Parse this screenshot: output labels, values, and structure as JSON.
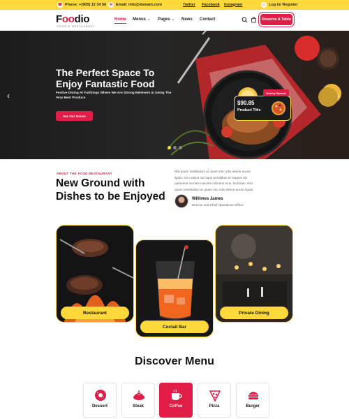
{
  "topbar": {
    "phone": "Phone: +(900) 12 34 56",
    "email": "Email: info@domain.com",
    "links": [
      "Twitter",
      "Facebook",
      "Instagram"
    ],
    "login": "Log in/ Register"
  },
  "header": {
    "logo": "Foodio",
    "logo_sub": "FOOD'S RESTAURANT",
    "nav": [
      {
        "label": "Home"
      },
      {
        "label": "Menus"
      },
      {
        "label": "Pages"
      },
      {
        "label": "News"
      },
      {
        "label": "Contact"
      }
    ],
    "reserve_button": "Reserve A Table"
  },
  "hero": {
    "title": "The Perfect Space To Enjoy Fantastic Food",
    "description": "Festive Dining At Farthings Where We Are Strong Believers In Using The Very Best Produce",
    "button": "See Our Menus",
    "slide_count": 3,
    "active_slide": 1,
    "special": {
      "badge": "Weekly Special",
      "price": "$90.85",
      "name": "Product Title"
    }
  },
  "about": {
    "kicker": "ABOUT THE FOOD RESTAURANT",
    "title": "New Ground with Dishes to be Enjoyed",
    "paragraph": "Nisl quam nestibulum ac quam nec odio eleme aucan ligula. Orci varius nat oque penatibus et magnis dis parturient montes nascete ridiculus mus. Null tiam. Nisl quam nestibulum ac quam nec odio eleme aucan ligula.",
    "person": {
      "name": "Willimes James",
      "role": "Director and Chief Operations Officer"
    }
  },
  "cards": [
    {
      "label": "Restaurant"
    },
    {
      "label": "Coctail Bar"
    },
    {
      "label": "Private Dining"
    }
  ],
  "discover": {
    "title": "Discover Menu",
    "items": [
      {
        "label": "Dessert",
        "icon": "donut-icon",
        "active": false
      },
      {
        "label": "Steak",
        "icon": "steak-icon",
        "active": false
      },
      {
        "label": "Coffee",
        "icon": "coffee-icon",
        "active": true
      },
      {
        "label": "Pizza",
        "icon": "pizza-icon",
        "active": false
      },
      {
        "label": "Burger",
        "icon": "burger-icon",
        "active": false
      }
    ]
  },
  "colors": {
    "accent": "#e11d48",
    "yellow": "#ffd83a",
    "dark": "#1c1c1c"
  }
}
